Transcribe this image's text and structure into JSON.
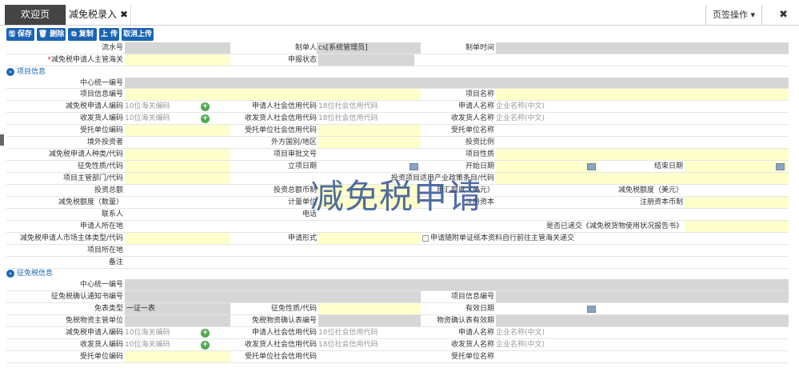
{
  "tabs": {
    "welcome": "欢迎页",
    "active": "减免税录入",
    "close": "✖",
    "page_ops": "页签操作 ▾",
    "fullscreen": "✖"
  },
  "toolbar": {
    "save": "🖫 保存",
    "delete": "🗑 删除",
    "copy": "⧉ 复制",
    "upload": "上 传",
    "cancel_upload": "取消上传"
  },
  "header": {
    "serial_label": "流水号",
    "creator_label": "制单人",
    "creator_value": "cs[系统管理员]",
    "created_time_label": "制单时间",
    "customs_label": "减免税申请人主管海关",
    "customs_required": "*",
    "status_label": "申报状态"
  },
  "section1": {
    "title": "项目信息",
    "icon": "»"
  },
  "section2": {
    "title": "征免税信息",
    "icon": "»"
  },
  "placeholders": {
    "customs_code": "10位海关编码",
    "credit_code": "18位社会信用代码",
    "company_name": "企业名称(中文)"
  },
  "p": {
    "center_code": "中心统一编号",
    "project_info_no": "项目信息编号",
    "project_name": "项目名称",
    "applicant_code": "减免税申请人编码",
    "applicant_credit": "申请人社会信用代码",
    "applicant_name": "申请人名称",
    "consignee_code": "收发货人编码",
    "consignee_credit": "收发货人社会信用代码",
    "consignee_name": "收发货人名称",
    "entrusted_code": "受托单位编码",
    "entrusted_credit": "受托单位社会信用代码",
    "entrusted_name": "受托单位名称",
    "foreign_investor": "境外投资者",
    "foreign_country": "外方国别/地区",
    "invest_ratio": "投资比例",
    "applicant_type": "减免税申请人种类/代码",
    "approval_no": "项目审批文号",
    "project_nature": "项目性质",
    "levy_nature": "征免性质/代码",
    "project_date": "立项日期",
    "start_date": "开始日期",
    "end_date": "结束日期",
    "project_dept": "项目主管部门/代码",
    "policy_item": "投资项目适用产业政策条目/代码",
    "total_invest": "投资总额",
    "invest_currency": "投资总额币制",
    "usd_amount": "用汇额度（美元）",
    "exempt_usd": "减免税额度（美元）",
    "exempt_qty": "减免税额度（数量）",
    "unit": "计量单位",
    "reg_capital": "注册资本",
    "reg_currency": "注册资本币制",
    "contact": "联系人",
    "phone": "电话",
    "applicant_location": "申请人所在地",
    "report_submitted": "是否已递交《减免税货物使用状况报告书》",
    "market_type": "减免税申请人市场主体类型/代码",
    "apply_form": "申请形式",
    "paper_note": "申请随附单证纸本资料自行前往主管海关递交",
    "project_location": "项目所在地",
    "remarks": "备注"
  },
  "s": {
    "center_code": "中心统一编号",
    "notice_no": "征免税确认通知书编号",
    "project_info_no": "项目信息编号",
    "exempt_type": "免表类型",
    "exempt_type_value": "一证一表",
    "levy_nature": "征免性质/代码",
    "valid_date": "有效日期",
    "goods_dept": "免税物资主管单位",
    "goods_approval_no": "免税物资确认表编号",
    "goods_valid": "物资确认表有效期",
    "applicant_code": "减免税申请人编码",
    "applicant_credit": "申请人社会信用代码",
    "applicant_name": "申请人名称",
    "consignee_code": "收发货人编码",
    "consignee_credit": "收发货人社会信用代码",
    "consignee_name": "收发货人名称",
    "entrusted_code": "受托单位编码",
    "entrusted_credit": "受托单位社会信用代码",
    "entrusted_name": "受托单位名称"
  },
  "watermark": "减免税申请",
  "icons": {
    "plus": "+"
  }
}
